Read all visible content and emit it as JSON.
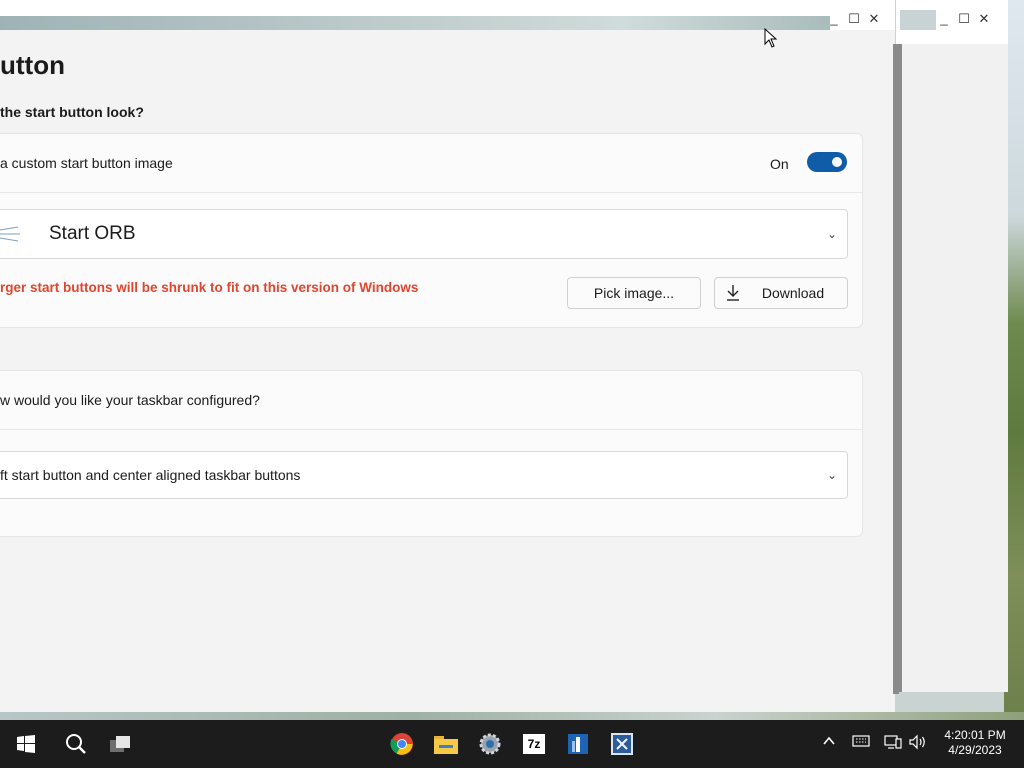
{
  "main": {
    "title": "utton",
    "section1_heading": "the start button look?",
    "custom_image_label": "a custom start button image",
    "toggle_state": "On",
    "toggle_on": true,
    "orb_selection": "Start ORB",
    "warning": "rger start buttons will be shrunk to fit on this version of Windows",
    "pick_image_label": "Pick image...",
    "download_label": "Download",
    "taskbar_question": "w would you like your taskbar configured?",
    "taskbar_selection": "ft start button and center aligned taskbar buttons"
  },
  "taskbar": {
    "apps": [
      "windows-start-icon",
      "search-icon",
      "task-view-icon",
      "chrome-icon",
      "file-explorer-icon",
      "settings-icon",
      "7zip-icon",
      "app-blue-icon",
      "app-framed-icon"
    ],
    "zip_label": "7z",
    "time": "4:20:01 PM",
    "date": "4/29/2023"
  },
  "colors": {
    "accent": "#0f5ca8",
    "warning": "#e0462e",
    "taskbar": "#1c1c1c"
  }
}
